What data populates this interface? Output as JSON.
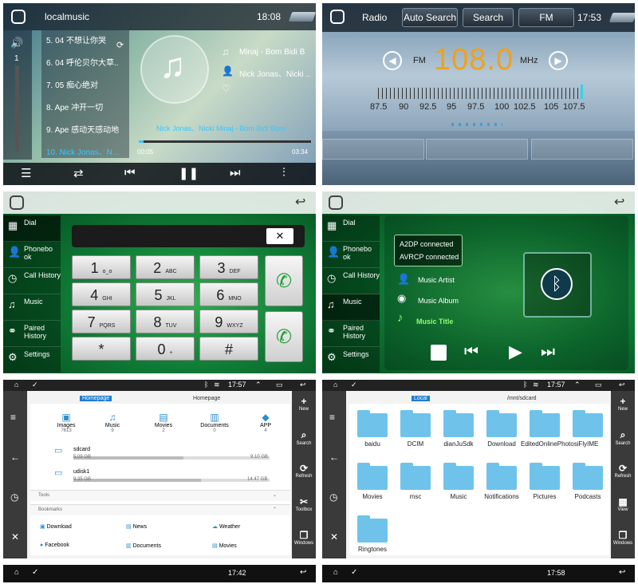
{
  "music": {
    "title": "localmusic",
    "time": "18:08",
    "volume": "1",
    "tracks": [
      "5. 04 不想让你哭",
      "6. 04 呼伦贝尔大草..",
      "7. 05 痴心绝对",
      "8. Ape 冲开一切",
      "9. Ape 感动天感动地",
      "10. Nick Jonas、N..."
    ],
    "song": "Minaj - Bom Bidi B",
    "artist": "Nick Jonas、Nicki ...",
    "marquee": "Nick Jonas、Nicki Minaj - Bom Bidi Bom",
    "elapsed": "00:05",
    "total": "03:34"
  },
  "radio": {
    "title": "Radio",
    "auto_search": "Auto Search",
    "search": "Search",
    "band": "FM",
    "time": "17:53",
    "band_label": "FM",
    "freq": "108.0",
    "unit": "MHz",
    "scale": [
      "87.5",
      "90",
      "92.5",
      "95",
      "97.5",
      "100",
      "102.5",
      "105",
      "107.5"
    ]
  },
  "phone": {
    "sidebar": [
      "Dial",
      "Phonebo ok",
      "Call History",
      "Music",
      "Paired History",
      "Settings"
    ],
    "keys": [
      [
        "1",
        "o_o"
      ],
      [
        "2",
        "ABC"
      ],
      [
        "3",
        "DEF"
      ],
      [
        "4",
        "GHI"
      ],
      [
        "5",
        "JKL"
      ],
      [
        "6",
        "MNO"
      ],
      [
        "7",
        "PQRS"
      ],
      [
        "8",
        "TUV"
      ],
      [
        "9",
        "WXYZ"
      ],
      [
        "*",
        ""
      ],
      [
        "0",
        "+"
      ],
      [
        "#",
        ""
      ]
    ]
  },
  "bt": {
    "sidebar": [
      "Dial",
      "Phonebo ok",
      "Call History",
      "Music",
      "Paired History",
      "Settings"
    ],
    "a2dp": "A2DP connected",
    "avrcp": "AVRCP connected",
    "artist": "Music Artist",
    "album": "Music Album",
    "track": "Music Title"
  },
  "fm1": {
    "time": "17:57",
    "tab": "Homepage",
    "path": "Homepage",
    "cats": [
      [
        "Images",
        "7613"
      ],
      [
        "Music",
        "9"
      ],
      [
        "Movies",
        "2"
      ],
      [
        "Documents",
        "0"
      ],
      [
        "APP",
        "4"
      ]
    ],
    "drives": [
      [
        "sdcard",
        "5.09 GB",
        "9.10 GB"
      ],
      [
        "udisk1",
        "9.35 GB",
        "14.47 GB"
      ]
    ],
    "tools": "Tools",
    "bookmarks": "Bookmarks",
    "links": [
      "Download",
      "News",
      "Weather",
      "Facebook",
      "Documents",
      "Movies"
    ],
    "right": [
      "New",
      "Search",
      "Refresh",
      "Toolbox",
      "Windows"
    ],
    "bottom_time": "17:42"
  },
  "fm2": {
    "time": "17:57",
    "tab": "Local",
    "path": "/mnt/sdcard",
    "folders": [
      "baidu",
      "DCIM",
      "dianJuSdk",
      "Download",
      "EditedOnlinePhotos",
      "iFlyIME",
      "Movies",
      "msc",
      "Music",
      "Notifications",
      "Pictures",
      "Podcasts",
      "Ringtones"
    ],
    "right": [
      "New",
      "Search",
      "Refresh",
      "View",
      "Windows"
    ],
    "bottom_time": "17:58"
  }
}
